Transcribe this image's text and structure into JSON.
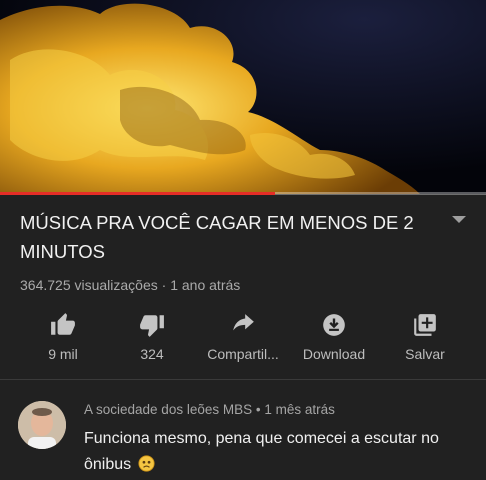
{
  "video": {
    "progress_fraction": 0.565
  },
  "title": "MÚSICA PRA VOCÊ CAGAR EM MENOS DE 2 MINUTOS",
  "meta": {
    "views": "364.725 visualizações",
    "separator": " · ",
    "age": "1 ano atrás"
  },
  "actions": [
    {
      "icon": "thumbs-up-icon",
      "label": "9 mil"
    },
    {
      "icon": "thumbs-down-icon",
      "label": "324"
    },
    {
      "icon": "share-icon",
      "label": "Compartil..."
    },
    {
      "icon": "download-icon",
      "label": "Download"
    },
    {
      "icon": "add-to-playlist-icon",
      "label": "Salvar"
    }
  ],
  "comment": {
    "author": "A sociedade dos leões MBS",
    "separator": " • ",
    "age": "1 mês atrás",
    "text": "Funciona mesmo, pena que comecei a escutar no ônibus",
    "emoji": "sad-face-emoji"
  }
}
